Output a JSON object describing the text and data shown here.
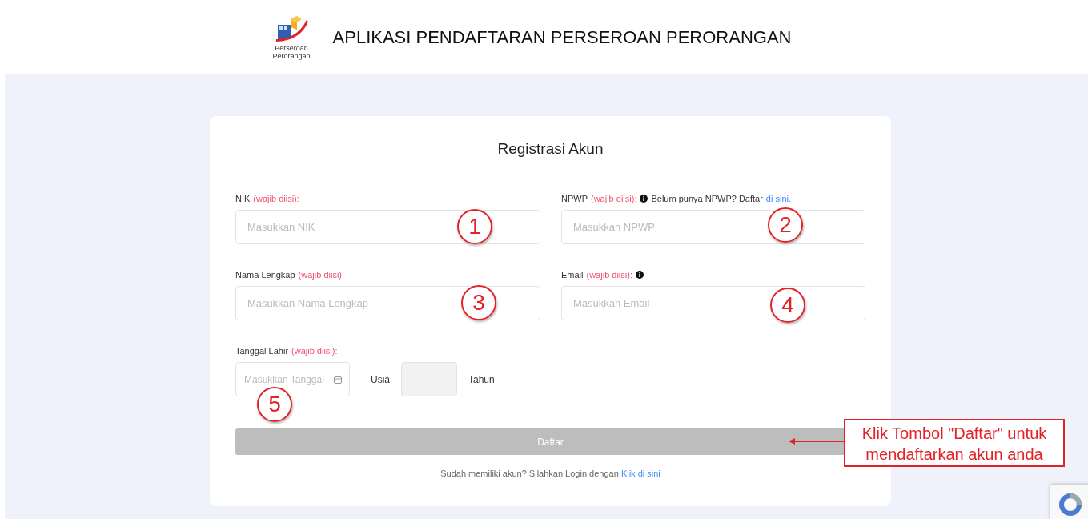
{
  "header": {
    "logo_lines": [
      "Perseroan",
      "Perorangan"
    ],
    "title": "APLIKASI PENDAFTARAN PERSEROAN PERORANGAN"
  },
  "form": {
    "title": "Registrasi Akun",
    "fields": [
      {
        "kind": "text",
        "label": "NIK",
        "required_note": "(wajib diisi):",
        "placeholder": "Masukkan NIK"
      },
      {
        "kind": "text",
        "label": "NPWP",
        "required_note": "(wajib diisi):",
        "info_icon": true,
        "hint": "Belum punya NPWP? Daftar",
        "hint_link": "di sini.",
        "placeholder": "Masukkan NPWP"
      },
      {
        "kind": "text",
        "label": "Nama Lengkap",
        "required_note": "(wajib diisi):",
        "placeholder": "Masukkan Nama Lengkap"
      },
      {
        "kind": "text",
        "label": "Email",
        "required_note": "(wajib diisi):",
        "info_icon": true,
        "placeholder": "Masukkan Email"
      },
      {
        "kind": "date",
        "label": "Tanggal Lahir",
        "required_note": "(wajib diisi):",
        "placeholder": "Masukkan Tanggal",
        "age_label": "Usia",
        "age_unit": "Tahun"
      }
    ],
    "submit": {
      "label": "Daftar",
      "disabled": true
    },
    "footer": {
      "text": "Sudah memiliki akun? Silahkan Login dengan",
      "link": "Klik di sini"
    }
  },
  "annotations": {
    "markers": [
      "1",
      "2",
      "3",
      "4",
      "5"
    ],
    "callout": "Klik Tombol \"Daftar\" untuk mendaftarkan akun anda"
  }
}
